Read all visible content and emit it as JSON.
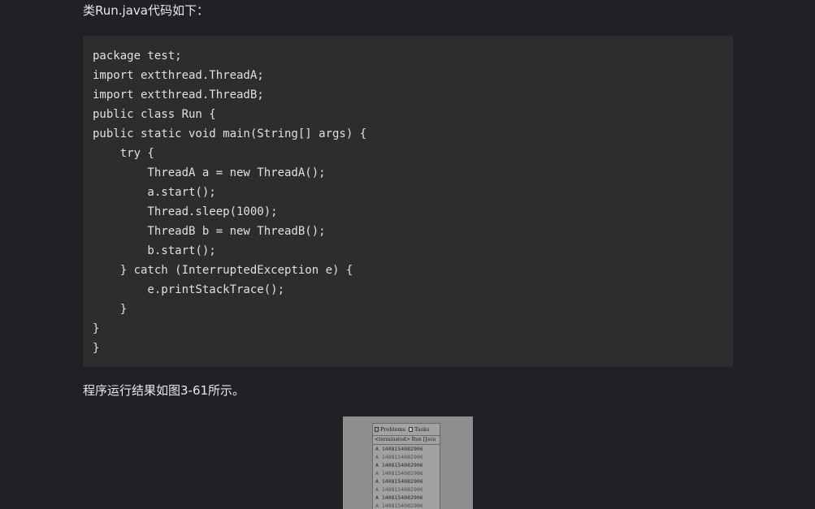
{
  "intro_text": "类Run.java代码如下：",
  "code_lines": [
    "package test;",
    "import extthread.ThreadA;",
    "import extthread.ThreadB;",
    "public class Run {",
    "public static void main(String[] args) {",
    "    try {",
    "        ThreadA a = new ThreadA();",
    "        a.start();",
    "        Thread.sleep(1000);",
    "        ThreadB b = new ThreadB();",
    "        b.start();",
    "    } catch (InterruptedException e) {",
    "        e.printStackTrace();",
    "    }",
    "}",
    "}"
  ],
  "result_text": "程序运行结果如图3-61所示。",
  "figure": {
    "tabs": [
      {
        "label": "Problems",
        "icon": "problems-icon"
      },
      {
        "label": "Tasks",
        "icon": "tasks-icon"
      }
    ],
    "header": "<terminated> Run [Java",
    "lines": [
      "A 1408154082906",
      "A 1408154082906",
      "A 1408154082906",
      "A 1408154082906",
      "A 1408154082906",
      "A 1408154082906",
      "A 1408154082906",
      "A 1408154082906"
    ]
  },
  "colors": {
    "page_bg": "#202124",
    "code_bg": "#2d2d2d",
    "text": "#e8e8e8"
  }
}
